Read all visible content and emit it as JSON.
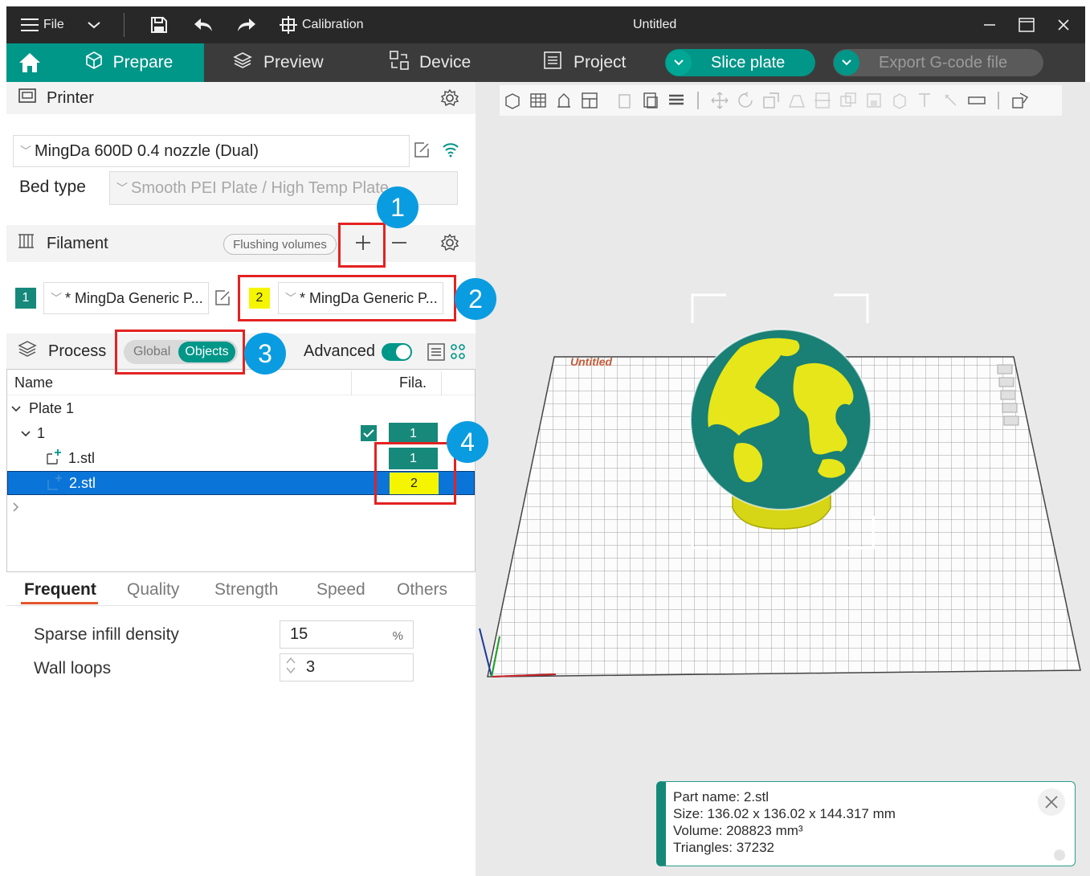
{
  "titlebar": {
    "file_label": "File",
    "calibration_label": "Calibration",
    "window_title": "Untitled"
  },
  "tabs": {
    "prepare": "Prepare",
    "preview": "Preview",
    "device": "Device",
    "project": "Project",
    "slice_plate": "Slice plate",
    "export_gcode": "Export G-code file"
  },
  "printer": {
    "section_title": "Printer",
    "selected_printer": "MingDa 600D 0.4 nozzle (Dual)",
    "bed_type_label": "Bed type",
    "bed_type_value": "Smooth PEI Plate / High Temp Plate"
  },
  "filament": {
    "section_title": "Filament",
    "flushing_volumes_label": "Flushing volumes",
    "slots": [
      {
        "index": "1",
        "name": "* MingDa Generic P...",
        "color": "#17897b"
      },
      {
        "index": "2",
        "name": "* MingDa Generic P...",
        "color": "#f5f500"
      }
    ]
  },
  "process": {
    "section_title": "Process",
    "mode_global": "Global",
    "mode_objects": "Objects",
    "advanced_label": "Advanced",
    "advanced_on": true
  },
  "object_list": {
    "col_name": "Name",
    "col_fila": "Fila.",
    "plate_label": "Plate 1",
    "object_label": "1",
    "object_fila": "1",
    "parts": [
      {
        "name": "1.stl",
        "fila": "1",
        "selected": false
      },
      {
        "name": "2.stl",
        "fila": "2",
        "selected": true
      }
    ]
  },
  "param_tabs": [
    "Frequent",
    "Quality",
    "Strength",
    "Speed",
    "Others"
  ],
  "active_param_tab": "Frequent",
  "params": {
    "sparse_infill_label": "Sparse infill density",
    "sparse_infill_value": "15",
    "sparse_infill_unit": "%",
    "wall_loops_label": "Wall loops",
    "wall_loops_value": "3"
  },
  "annotations": [
    "1",
    "2",
    "3",
    "4"
  ],
  "viewport": {
    "plate_label": "Untitled"
  },
  "part_info": {
    "line1": "Part name: 2.stl",
    "line2": "Size: 136.02 x 136.02 x 144.317 mm",
    "line3": "Volume: 208823 mm³",
    "line4": "Triangles: 37232"
  },
  "colors": {
    "accent": "#009688",
    "selection": "#0b74d8",
    "annotation_red": "#e32222",
    "annotation_blue": "#0a9ce0",
    "globe_land": "#e6e61a",
    "globe_ocean": "#1a7f74"
  }
}
